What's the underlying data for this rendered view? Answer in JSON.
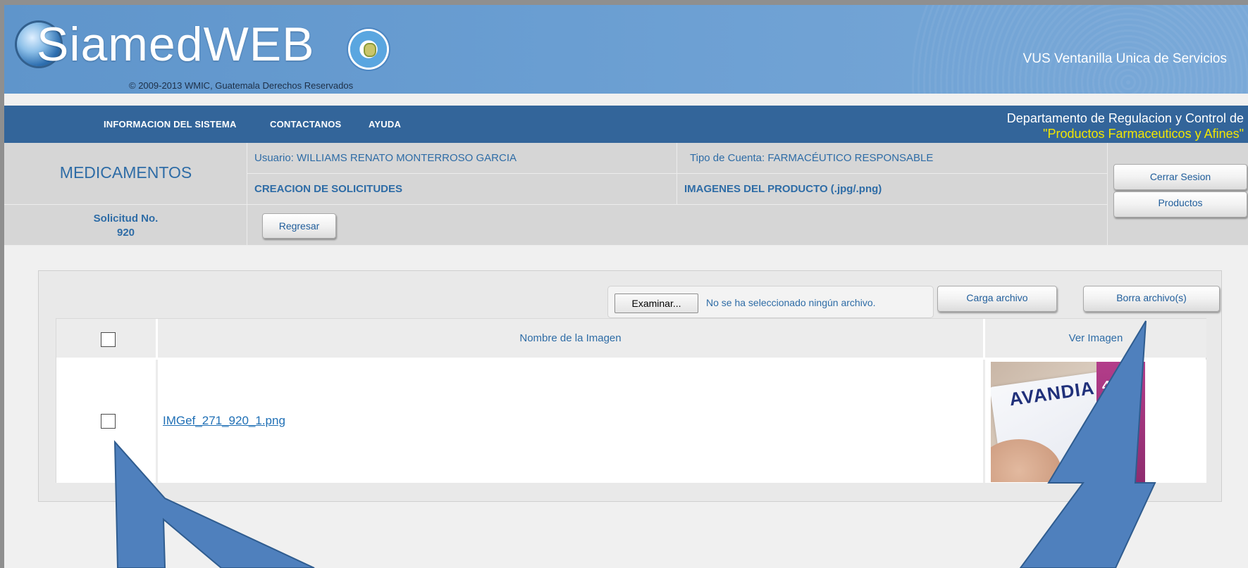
{
  "header": {
    "logo_text": "SiamedWEB",
    "copyright": "© 2009-2013 WMIC, Guatemala Derechos Reservados",
    "service_name": "VUS Ventanilla Unica de Servicios"
  },
  "nav": {
    "items": [
      "INFORMACION DEL SISTEMA",
      "CONTACTANOS",
      "AYUDA"
    ],
    "department_line1": "Departamento de Regulacion y Control de",
    "department_line2": "\"Productos Farmaceuticos y Afines\""
  },
  "info": {
    "section_title": "MEDICAMENTOS",
    "user": "Usuario: WILLIAMS RENATO MONTERROSO GARCIA",
    "account_type": "Tipo de Cuenta: FARMACÉUTICO RESPONSABLE",
    "current_step": "CREACION DE SOLICITUDES",
    "current_page": "IMAGENES DEL PRODUCTO (.jpg/.png)",
    "request_label": "Solicitud No.",
    "request_number": "920",
    "back_button": "Regresar",
    "logout_button": "Cerrar Sesion",
    "products_button": "Productos"
  },
  "upload": {
    "browse_button": "Examinar...",
    "no_file_text": "No se ha seleccionado ningún archivo.",
    "upload_button": "Carga archivo",
    "delete_button": "Borra archivo(s)"
  },
  "table": {
    "columns": [
      "",
      "Nombre de la Imagen",
      "Ver Imagen"
    ],
    "rows": [
      {
        "checked": false,
        "name": "IMGef_271_920_1.png",
        "thumb_brand": "AVANDIA",
        "thumb_dose": "4 m"
      }
    ]
  },
  "colors": {
    "header_blue": "#6a9ed2",
    "nav_blue": "#33659a",
    "accent_text": "#2e6ca6",
    "highlight_yellow": "#f2e600",
    "annotation_arrow": "#4f80bd"
  }
}
